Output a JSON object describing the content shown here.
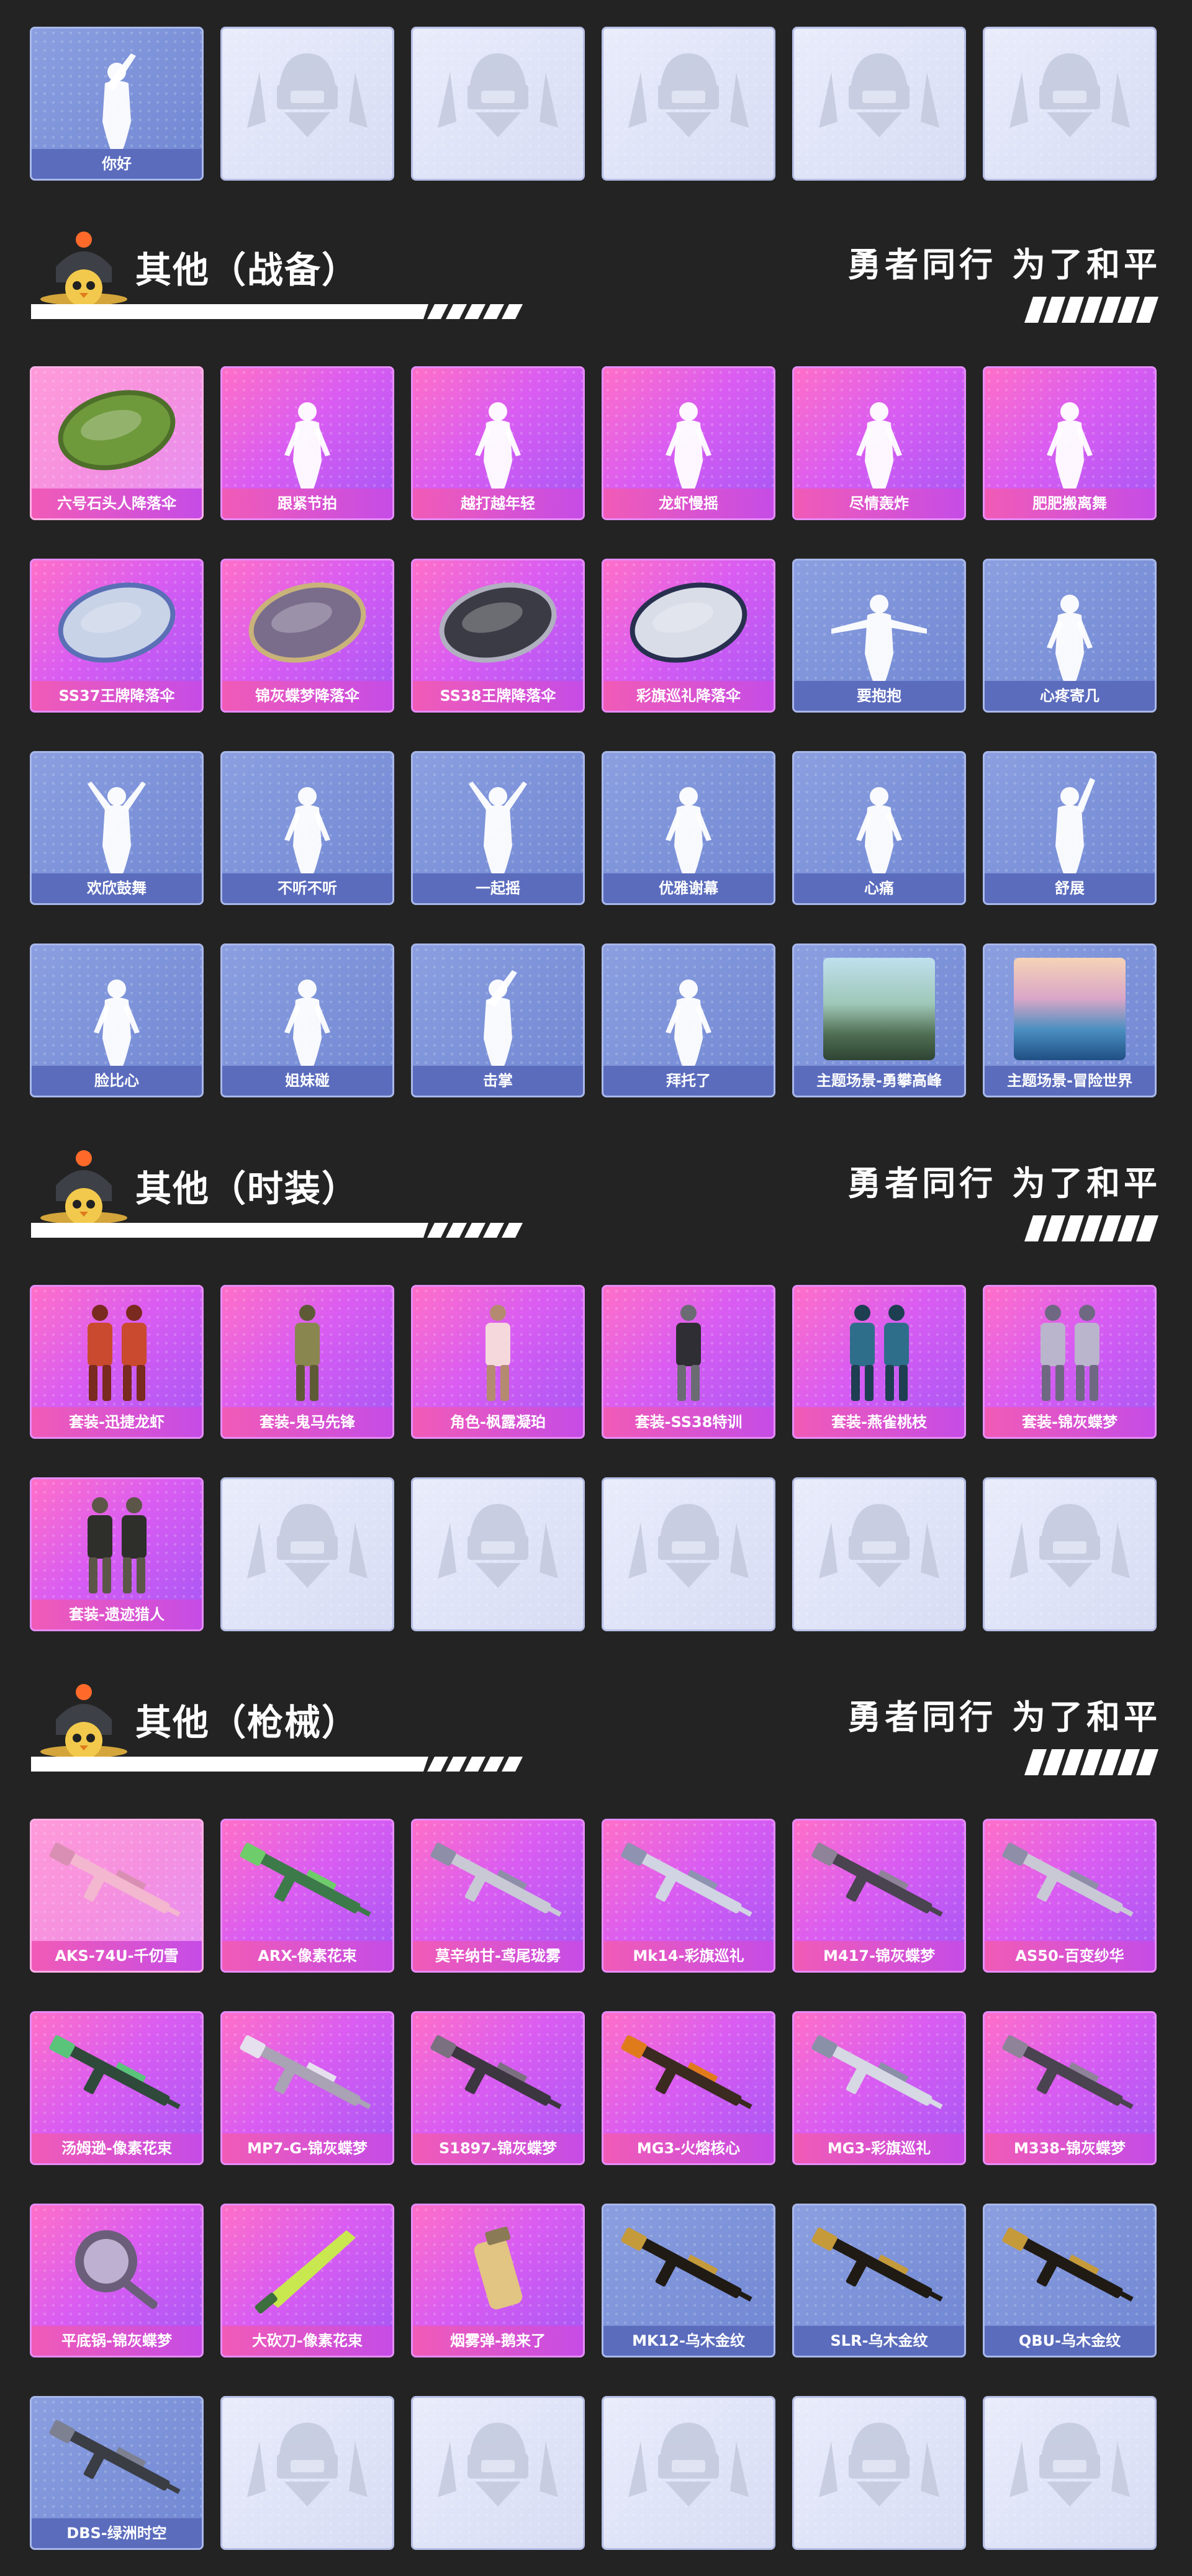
{
  "top_row": [
    {
      "label": "你好",
      "style": "blue",
      "art": "wave-emote"
    },
    {
      "label": "",
      "style": "empty",
      "art": "empty"
    },
    {
      "label": "",
      "style": "empty",
      "art": "empty"
    },
    {
      "label": "",
      "style": "empty",
      "art": "empty"
    },
    {
      "label": "",
      "style": "empty",
      "art": "empty"
    },
    {
      "label": "",
      "style": "empty",
      "art": "empty"
    }
  ],
  "sections": [
    {
      "title": "其他（战备）",
      "slogan": "勇者同行 为了和平",
      "items": [
        {
          "label": "六号石头人降落伞",
          "style": "pink-light",
          "art": "parachute-green"
        },
        {
          "label": "跟紧节拍",
          "style": "pink",
          "art": "dance-emote"
        },
        {
          "label": "越打越年轻",
          "style": "pink",
          "art": "dance-emote"
        },
        {
          "label": "龙虾慢摇",
          "style": "pink",
          "art": "dance-emote"
        },
        {
          "label": "尽情轰炸",
          "style": "pink",
          "art": "dance-emote"
        },
        {
          "label": "肥肥搬离舞",
          "style": "pink",
          "art": "dance-emote"
        },
        {
          "label": "SS37王牌降落伞",
          "style": "pink",
          "art": "parachute-ss37"
        },
        {
          "label": "锦灰蝶梦降落伞",
          "style": "pink",
          "art": "parachute-butterfly"
        },
        {
          "label": "SS38王牌降落伞",
          "style": "pink",
          "art": "parachute-ss38"
        },
        {
          "label": "彩旗巡礼降落伞",
          "style": "pink",
          "art": "parachute-flags"
        },
        {
          "label": "要抱抱",
          "style": "blue",
          "art": "hug-emote"
        },
        {
          "label": "心疼寄几",
          "style": "blue",
          "art": "self-hug-emote"
        },
        {
          "label": "欢欣鼓舞",
          "style": "blue",
          "art": "cheer-emote"
        },
        {
          "label": "不听不听",
          "style": "blue",
          "art": "cover-ears-emote"
        },
        {
          "label": "一起摇",
          "style": "blue",
          "art": "sway-emote"
        },
        {
          "label": "优雅谢幕",
          "style": "blue",
          "art": "bow-emote"
        },
        {
          "label": "心痛",
          "style": "blue",
          "art": "heartache-emote"
        },
        {
          "label": "舒展",
          "style": "blue",
          "art": "stretch-emote"
        },
        {
          "label": "脸比心",
          "style": "blue",
          "art": "face-heart-emote"
        },
        {
          "label": "姐妹碰",
          "style": "blue",
          "art": "hip-bump-emote"
        },
        {
          "label": "击掌",
          "style": "blue",
          "art": "high-five-emote"
        },
        {
          "label": "拜托了",
          "style": "blue",
          "art": "please-emote"
        },
        {
          "label": "主题场景-勇攀高峰",
          "style": "blue",
          "art": "scene-mountain"
        },
        {
          "label": "主题场景-冒险世界",
          "style": "blue",
          "art": "scene-sea"
        }
      ]
    },
    {
      "title": "其他（时装）",
      "slogan": "勇者同行 为了和平",
      "items": [
        {
          "label": "套装-迅捷龙虾",
          "style": "pink",
          "art": "outfit-pair-red"
        },
        {
          "label": "套装-鬼马先锋",
          "style": "pink",
          "art": "outfit-khaki"
        },
        {
          "label": "角色-枫露凝珀",
          "style": "pink",
          "art": "character-girl"
        },
        {
          "label": "套装-SS38特训",
          "style": "pink",
          "art": "outfit-flat-black"
        },
        {
          "label": "套装-燕雀桃枝",
          "style": "pink",
          "art": "outfit-pair-teal"
        },
        {
          "label": "套装-锦灰蝶梦",
          "style": "pink",
          "art": "outfit-pair-silver"
        },
        {
          "label": "套装-遗迹猎人",
          "style": "pink",
          "art": "outfit-pair-dark"
        },
        {
          "label": "",
          "style": "empty",
          "art": "empty"
        },
        {
          "label": "",
          "style": "empty",
          "art": "empty"
        },
        {
          "label": "",
          "style": "empty",
          "art": "empty"
        },
        {
          "label": "",
          "style": "empty",
          "art": "empty"
        },
        {
          "label": "",
          "style": "empty",
          "art": "empty"
        }
      ]
    },
    {
      "title": "其他（枪械）",
      "slogan": "勇者同行 为了和平",
      "items": [
        {
          "label": "AKS-74U-千仞雪",
          "style": "pink-light",
          "art": "rifle-pink"
        },
        {
          "label": "ARX-像素花束",
          "style": "pink",
          "art": "rifle-green"
        },
        {
          "label": "莫辛纳甘-鸢尾珑雾",
          "style": "pink",
          "art": "sniper-silver"
        },
        {
          "label": "Mk14-彩旗巡礼",
          "style": "pink",
          "art": "rifle-silver"
        },
        {
          "label": "M417-锦灰蝶梦",
          "style": "pink",
          "art": "rifle-dark"
        },
        {
          "label": "AS50-百变纱华",
          "style": "pink",
          "art": "sniper-silver"
        },
        {
          "label": "汤姆逊-像素花束",
          "style": "pink",
          "art": "smg-green"
        },
        {
          "label": "MP7-G-锦灰蝶梦",
          "style": "pink",
          "art": "smg-silver"
        },
        {
          "label": "S1897-锦灰蝶梦",
          "style": "pink",
          "art": "shotgun-dark"
        },
        {
          "label": "MG3-火熔核心",
          "style": "pink",
          "art": "mg-dark"
        },
        {
          "label": "MG3-彩旗巡礼",
          "style": "pink",
          "art": "mg-silver"
        },
        {
          "label": "M338-锦灰蝶梦",
          "style": "pink",
          "art": "rifle-dark"
        },
        {
          "label": "平底锅-锦灰蝶梦",
          "style": "pink",
          "art": "pan"
        },
        {
          "label": "大砍刀-像素花束",
          "style": "pink",
          "art": "machete"
        },
        {
          "label": "烟雾弹-鹅来了",
          "style": "pink",
          "art": "grenade"
        },
        {
          "label": "MK12-乌木金纹",
          "style": "blue",
          "art": "rifle-gold"
        },
        {
          "label": "SLR-乌木金纹",
          "style": "blue",
          "art": "rifle-gold"
        },
        {
          "label": "QBU-乌木金纹",
          "style": "blue",
          "art": "rifle-gold"
        },
        {
          "label": "DBS-绿洲时空",
          "style": "blue",
          "art": "shotgun-grey"
        },
        {
          "label": "",
          "style": "empty",
          "art": "empty"
        },
        {
          "label": "",
          "style": "empty",
          "art": "empty"
        },
        {
          "label": "",
          "style": "empty",
          "art": "empty"
        },
        {
          "label": "",
          "style": "empty",
          "art": "empty"
        },
        {
          "label": "",
          "style": "empty",
          "art": "empty"
        }
      ]
    }
  ]
}
